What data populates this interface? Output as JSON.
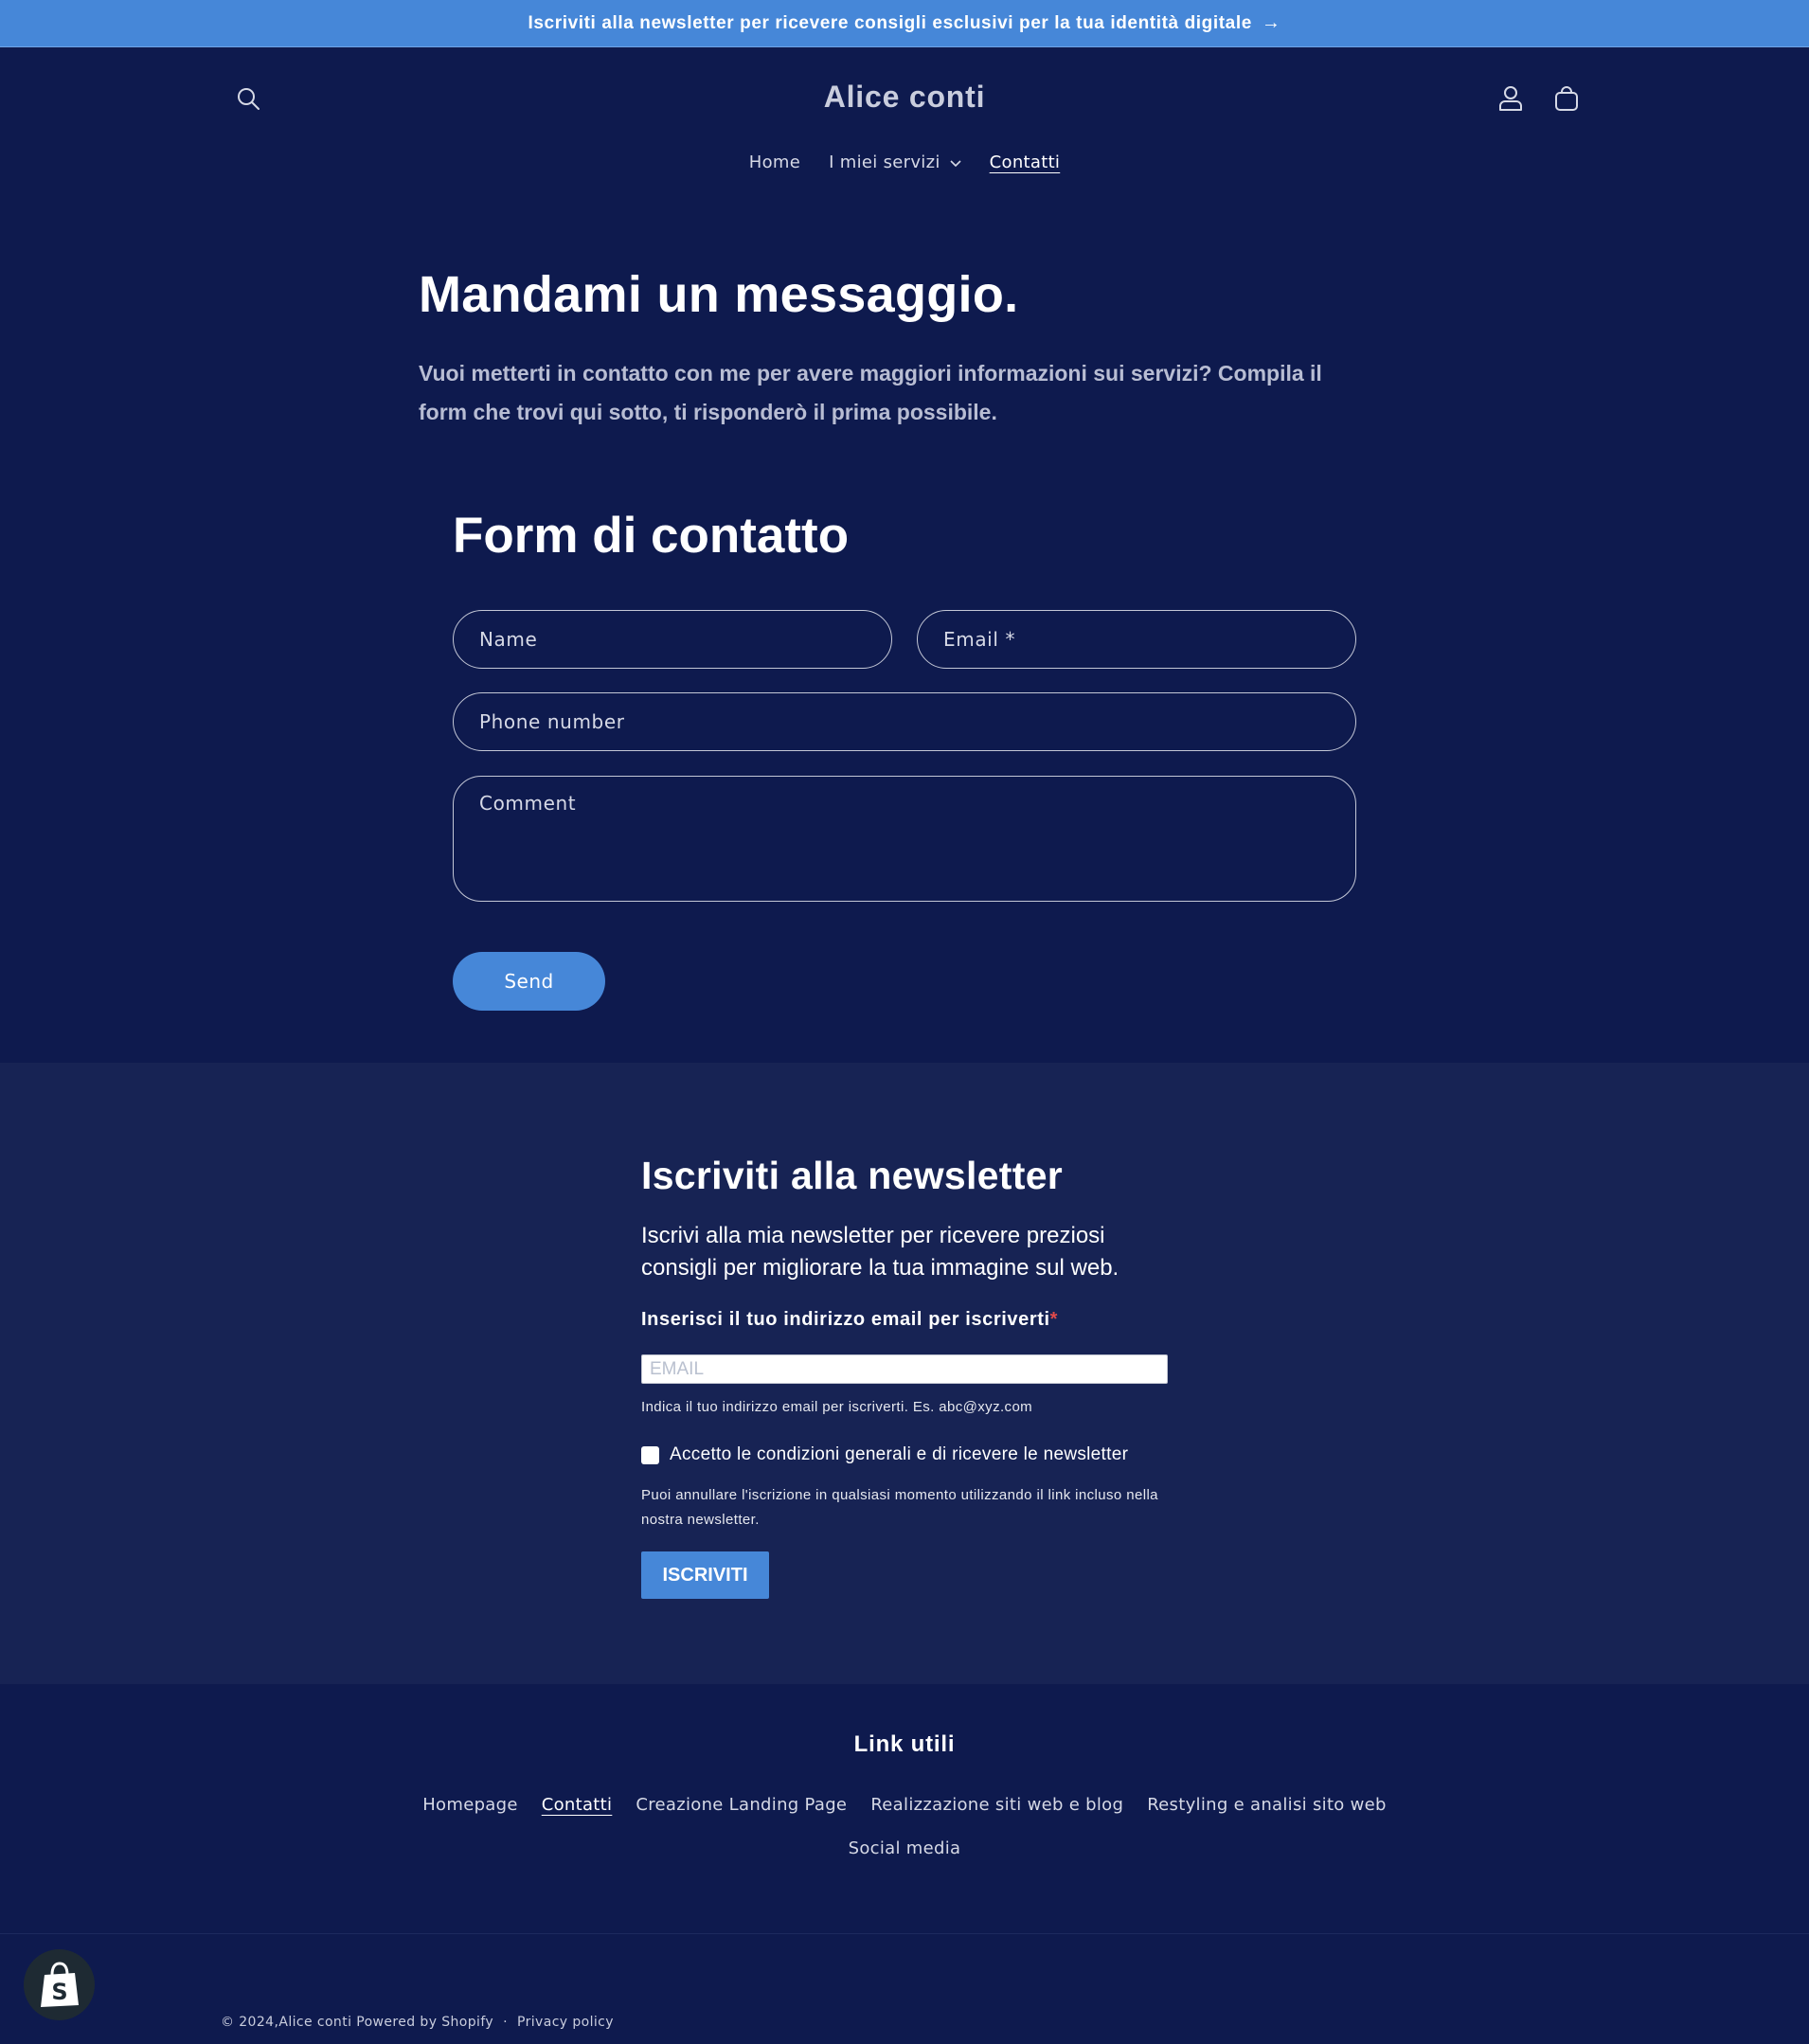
{
  "announcement": {
    "text": "Iscriviti alla newsletter per ricevere consigli esclusivi per la tua identità digitale",
    "arrow": "→"
  },
  "header": {
    "logo": "Alice conti",
    "nav": [
      {
        "label": "Home"
      },
      {
        "label": "I miei servizi"
      },
      {
        "label": "Contatti"
      }
    ]
  },
  "contact": {
    "heading": "Mandami un messaggio.",
    "intro": "Vuoi metterti in contatto con me per avere maggiori informazioni sui servizi? Compila il form che trovi qui sotto, ti risponderò il prima possibile.",
    "form_title": "Form di contatto",
    "fields": {
      "name": "Name",
      "email": "Email *",
      "phone": "Phone number",
      "comment": "Comment"
    },
    "send_label": "Send"
  },
  "newsletter": {
    "title": "Iscriviti alla newsletter",
    "description": "Iscrivi alla mia newsletter per ricevere preziosi consigli per migliorare la tua immagine sul web.",
    "email_label": "Inserisci il tuo indirizzo email per iscriverti",
    "required_mark": "*",
    "email_placeholder": "EMAIL",
    "hint": "Indica il tuo indirizzo email per iscriverti. Es. abc@xyz.com",
    "consent_label": "Accetto le condizioni generali e di ricevere le newsletter",
    "note": "Puoi annullare l'iscrizione in qualsiasi momento utilizzando il link incluso nella nostra newsletter.",
    "button_label": "ISCRIVITI"
  },
  "footer": {
    "title": "Link utili",
    "links": [
      {
        "label": "Homepage"
      },
      {
        "label": "Contatti"
      },
      {
        "label": "Creazione Landing Page"
      },
      {
        "label": "Realizzazione siti web e blog"
      },
      {
        "label": "Restyling e analisi sito web"
      },
      {
        "label": "Social media"
      }
    ],
    "copyright_prefix": "© 2024, ",
    "copyright_brand": "Alice conti",
    "powered_by": "Powered by Shopify",
    "separator": "·",
    "privacy": "Privacy policy"
  },
  "colors": {
    "background": "#0e1a4e",
    "newsletter_background": "#172354",
    "accent": "#4687d8"
  },
  "icons": [
    "search-icon",
    "account-icon",
    "cart-icon",
    "chevron-down-icon",
    "arrow-right-icon",
    "shopify-bag-icon"
  ]
}
